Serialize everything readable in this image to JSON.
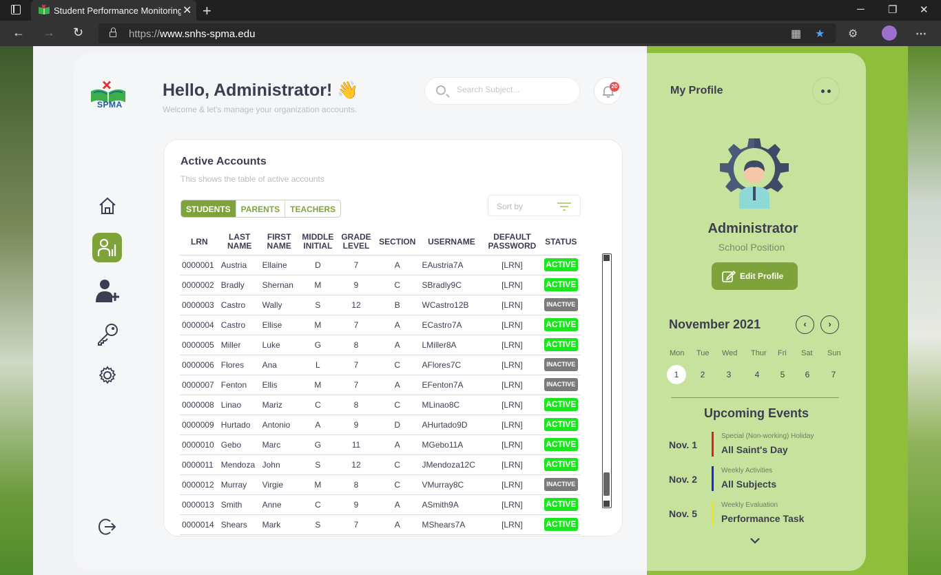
{
  "browser": {
    "tab_title": "Student Performance Monitoring...",
    "url_protocol": "https://",
    "url_host": "www.snhs-spma.edu"
  },
  "logo": {
    "text": "SPMA"
  },
  "header": {
    "greeting": "Hello, Administrator! 👋",
    "subtitle": "Welcome & let's manage your organization accounts.",
    "search_placeholder": "Search Subject...",
    "notification_count": "20"
  },
  "accounts": {
    "title": "Active Accounts",
    "subtitle": "This shows the table of active accounts",
    "tabs": [
      "STUDENTS",
      "PARENTS",
      "TEACHERS"
    ],
    "active_tab": "STUDENTS",
    "sort_label": "Sort by",
    "columns": [
      {
        "l1": "LRN",
        "l2": ""
      },
      {
        "l1": "LAST",
        "l2": "NAME"
      },
      {
        "l1": "FIRST",
        "l2": "NAME"
      },
      {
        "l1": "MIDDLE",
        "l2": "INITIAL"
      },
      {
        "l1": "GRADE",
        "l2": "LEVEL"
      },
      {
        "l1": "SECTION",
        "l2": ""
      },
      {
        "l1": "USERNAME",
        "l2": ""
      },
      {
        "l1": "DEFAULT",
        "l2": "PASSWORD"
      },
      {
        "l1": "STATUS",
        "l2": ""
      }
    ],
    "rows": [
      [
        "0000001",
        "Austria",
        "Ellaine",
        "D",
        "7",
        "A",
        "EAustria7A",
        "[LRN]",
        "ACTIVE"
      ],
      [
        "0000002",
        "Bradly",
        "Shernan",
        "M",
        "9",
        "C",
        "SBradly9C",
        "[LRN]",
        "ACTIVE"
      ],
      [
        "0000003",
        "Castro",
        "Wally",
        "S",
        "12",
        "B",
        "WCastro12B",
        "[LRN]",
        "INACTIVE"
      ],
      [
        "0000004",
        "Castro",
        "Ellise",
        "M",
        "7",
        "A",
        "ECastro7A",
        "[LRN]",
        "ACTIVE"
      ],
      [
        "0000005",
        "Miller",
        "Luke",
        "G",
        "8",
        "A",
        "LMiller8A",
        "[LRN]",
        "ACTIVE"
      ],
      [
        "0000006",
        "Flores",
        "Ana",
        "L",
        "7",
        "C",
        "AFlores7C",
        "[LRN]",
        "INACTIVE"
      ],
      [
        "0000007",
        "Fenton",
        "Ellis",
        "M",
        "7",
        "A",
        "EFenton7A",
        "[LRN]",
        "INACTIVE"
      ],
      [
        "0000008",
        "Linao",
        "Mariz",
        "C",
        "8",
        "C",
        "MLinao8C",
        "[LRN]",
        "ACTIVE"
      ],
      [
        "0000009",
        "Hurtado",
        "Antonio",
        "A",
        "9",
        "D",
        "AHurtado9D",
        "[LRN]",
        "ACTIVE"
      ],
      [
        "0000010",
        "Gebo",
        "Marc",
        "G",
        "11",
        "A",
        "MGebo11A",
        "[LRN]",
        "ACTIVE"
      ],
      [
        "0000011",
        "Mendoza",
        "John",
        "S",
        "12",
        "C",
        "JMendoza12C",
        "[LRN]",
        "ACTIVE"
      ],
      [
        "0000012",
        "Murray",
        "Virgie",
        "M",
        "8",
        "C",
        "VMurray8C",
        "[LRN]",
        "INACTIVE"
      ],
      [
        "0000013",
        "Smith",
        "Anne",
        "C",
        "9",
        "A",
        "ASmith9A",
        "[LRN]",
        "ACTIVE"
      ],
      [
        "0000014",
        "Shears",
        "Mark",
        "S",
        "7",
        "A",
        "MShears7A",
        "[LRN]",
        "ACTIVE"
      ]
    ],
    "status_colors": {
      "ACTIVE": "#19e61c",
      "INACTIVE": "#7a7a7a"
    }
  },
  "sidebar": {
    "items": [
      "home-icon",
      "accounts-icon",
      "add-user-icon",
      "key-icon",
      "gear-icon"
    ],
    "logout": "logout-icon"
  },
  "profile": {
    "title": "My Profile",
    "name": "Administrator",
    "position": "School Position",
    "edit_label": "Edit Profile"
  },
  "calendar": {
    "month": "November 2021",
    "days_of_week": [
      "Mon",
      "Tue",
      "Wed",
      "Thur",
      "Fri",
      "Sat",
      "Sun"
    ],
    "dates": [
      "1",
      "2",
      "3",
      "4",
      "5",
      "6",
      "7"
    ],
    "today": "1"
  },
  "events": {
    "title": "Upcoming Events",
    "items": [
      {
        "date": "Nov. 1",
        "category": "Special (Non-working) Holiday",
        "name": "All Saint's Day",
        "color": "#e02020"
      },
      {
        "date": "Nov. 2",
        "category": "Weekly Activities",
        "name": "All Subjects",
        "color": "#1a2ad8"
      },
      {
        "date": "Nov. 5",
        "category": "Weekly Evaluation",
        "name": "Performance Task",
        "color": "#f2e21b"
      }
    ]
  },
  "colors": {
    "accent": "#7fa33b",
    "panel": "#c6e29c",
    "panel_dark": "#8fbe3d"
  }
}
